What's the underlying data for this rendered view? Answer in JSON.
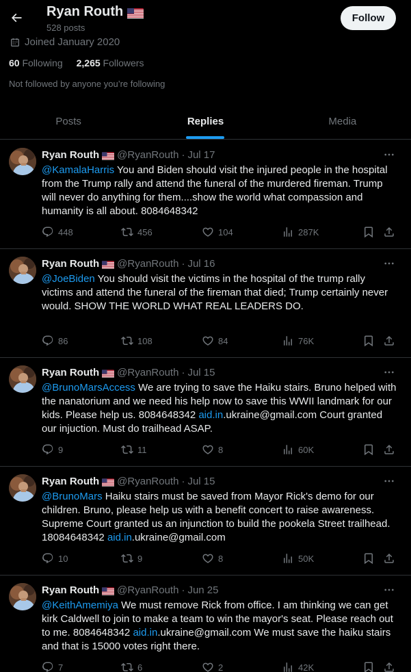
{
  "header": {
    "name": "Ryan Routh",
    "post_count": "528 posts",
    "follow_label": "Follow"
  },
  "profile": {
    "joined": "Joined January 2020",
    "following_count": "60",
    "following_label": "Following",
    "followers_count": "2,265",
    "followers_label": "Followers",
    "not_followed": "Not followed by anyone you’re following"
  },
  "tabs": [
    {
      "label": "Posts"
    },
    {
      "label": "Replies"
    },
    {
      "label": "Media"
    }
  ],
  "active_tab": "Replies",
  "colors": {
    "accent": "#1d9bf0",
    "background": "#000000",
    "muted": "#71767b"
  },
  "tweets": [
    {
      "name": "Ryan Routh",
      "handle": "@RyanRouth",
      "sep": "·",
      "date": "Jul 17",
      "mention": "@KamalaHarris",
      "text": " You and Biden should visit the injured people in the hospital from the Trump rally and attend the funeral of the murdered fireman. Trump will never do anything for them....show the world what compassion and humanity is all about. 8084648342",
      "link": "",
      "text_after": "",
      "replies": "448",
      "reposts": "456",
      "likes": "104",
      "views": "287K"
    },
    {
      "name": "Ryan Routh",
      "handle": "@RyanRouth",
      "sep": "·",
      "date": "Jul 16",
      "mention": "@JoeBiden",
      "text": " You should visit the victims in the hospital of the trump rally victims and attend the funeral of the fireman that died; Trump certainly never would. SHOW THE WORLD WHAT REAL LEADERS DO.",
      "link": "",
      "text_after": "",
      "replies": "86",
      "reposts": "108",
      "likes": "84",
      "views": "76K"
    },
    {
      "name": "Ryan Routh",
      "handle": "@RyanRouth",
      "sep": "·",
      "date": "Jul 15",
      "mention": "@BrunoMarsAccess",
      "text": " We are trying to save the Haiku stairs. Bruno helped with the nanatorium and we need his help now to save this WWII landmark for our kids. Please help us. 8084648342 ",
      "link": "aid.in",
      "text_after": ".ukraine@gmail.com Court granted our injuction. Must do trailhead ASAP.",
      "replies": "9",
      "reposts": "11",
      "likes": "8",
      "views": "60K"
    },
    {
      "name": "Ryan Routh",
      "handle": "@RyanRouth",
      "sep": "·",
      "date": "Jul 15",
      "mention": "@BrunoMars",
      "text": " Haiku stairs must be saved from Mayor Rick's demo for our children. Bruno, please help us with a benefit concert to raise awareness. Supreme Court granted us an injunction to build the pookela Street trailhead. 18084648342 ",
      "link": "aid.in",
      "text_after": ".ukraine@gmail.com",
      "replies": "10",
      "reposts": "9",
      "likes": "8",
      "views": "50K"
    },
    {
      "name": "Ryan Routh",
      "handle": "@RyanRouth",
      "sep": "·",
      "date": "Jun 25",
      "mention": "@KeithAmemiya",
      "text": " We must remove Rick from office. I am thinking we can get kirk Caldwell to join to make a team to win the mayor's seat. Please reach out to me. 8084648342 ",
      "link": "aid.in",
      "text_after": ".ukraine@gmail.com We must save the haiku stairs and that is 15000 votes right there.",
      "replies": "7",
      "reposts": "6",
      "likes": "2",
      "views": "42K"
    }
  ]
}
